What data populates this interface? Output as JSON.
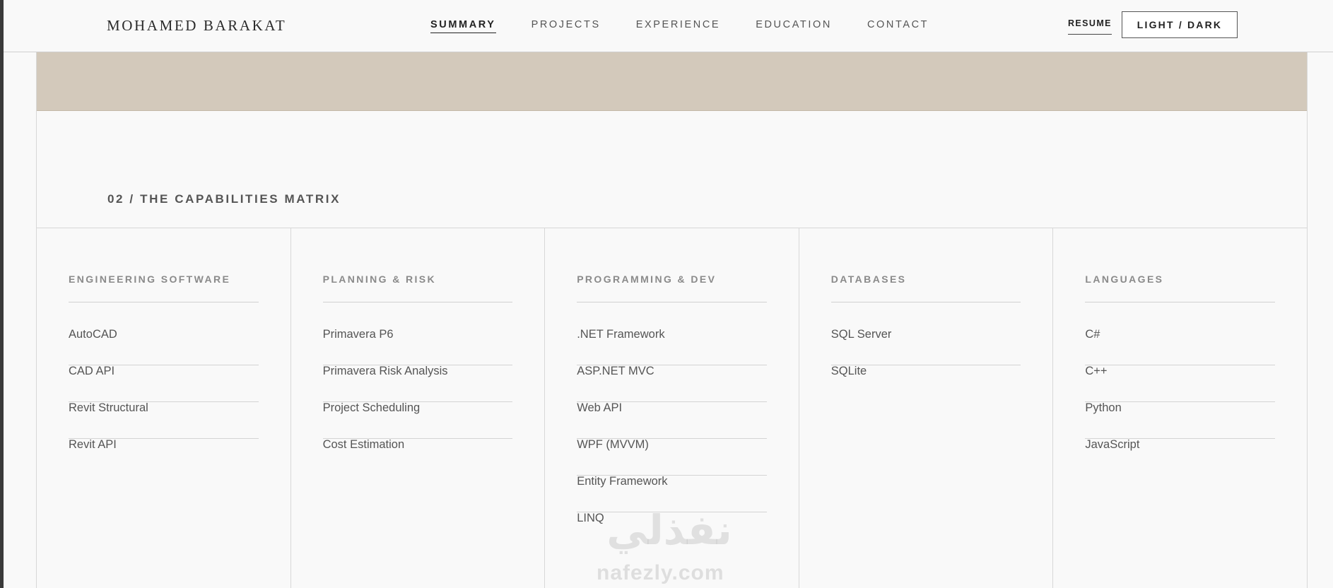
{
  "header": {
    "logo": "MOHAMED BARAKAT",
    "nav": [
      {
        "label": "SUMMARY",
        "active": true
      },
      {
        "label": "PROJECTS",
        "active": false
      },
      {
        "label": "EXPERIENCE",
        "active": false
      },
      {
        "label": "EDUCATION",
        "active": false
      },
      {
        "label": "CONTACT",
        "active": false
      }
    ],
    "resume_label": "RESUME",
    "theme_toggle_label": "LIGHT / DARK"
  },
  "colors": {
    "banner": "#d3c9bb",
    "background": "#f9f9f9",
    "accent_text": "#222222"
  },
  "section": {
    "title": "02 / THE CAPABILITIES MATRIX",
    "columns": [
      {
        "heading": "ENGINEERING SOFTWARE",
        "items": [
          "AutoCAD",
          "CAD API",
          "Revit Structural",
          "Revit API"
        ]
      },
      {
        "heading": "PLANNING & RISK",
        "items": [
          "Primavera P6",
          "Primavera Risk Analysis",
          "Project Scheduling",
          "Cost Estimation"
        ]
      },
      {
        "heading": "PROGRAMMING & DEV",
        "items": [
          ".NET Framework",
          "ASP.NET MVC",
          "Web API",
          "WPF (MVVM)",
          "Entity Framework",
          "LINQ"
        ]
      },
      {
        "heading": "DATABASES",
        "items": [
          "SQL Server",
          "SQLite"
        ]
      },
      {
        "heading": "LANGUAGES",
        "items": [
          "C#",
          "C++",
          "Python",
          "JavaScript"
        ]
      }
    ]
  },
  "watermark": {
    "arabic": "نفذلي",
    "latin": "nafezly.com"
  }
}
